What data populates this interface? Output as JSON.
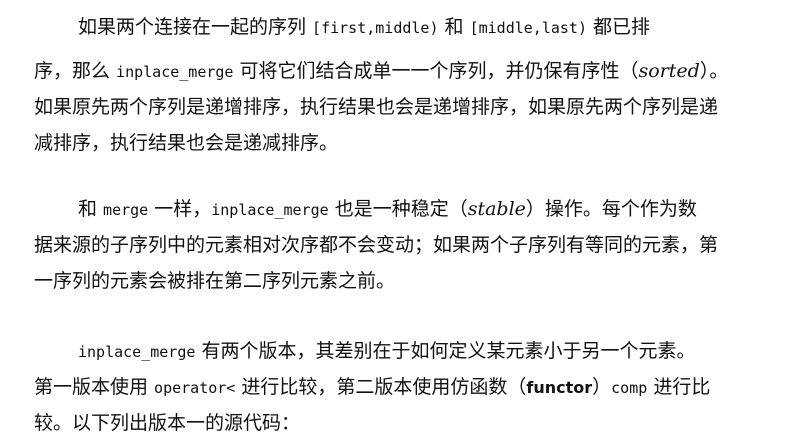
{
  "paragraphs": [
    {
      "lines": [
        [
          "如果两个连接在一起的序列 ",
          "[first,middle)",
          " 和 ",
          "[middle,last)",
          " 都已排"
        ],
        [
          "序，那么 ",
          "inplace_merge",
          " 可将它们结合成单一一个序列，并仍保有序性（",
          "sorted",
          "）。"
        ],
        [
          "如果原先两个序列是递增排序，执行结果也会是递增排序，如果原先两个序列是递"
        ],
        [
          "减排序，执行结果也会是递减排序。"
        ]
      ]
    },
    {
      "lines": [
        [
          "和 ",
          "merge",
          " 一样，",
          "inplace_merge",
          " 也是一种稳定（",
          "stable",
          "）操作。每个作为数"
        ],
        [
          "据来源的子序列中的元素相对次序都不会变动；如果两个子序列有等同的元素，第"
        ],
        [
          "一序列的元素会被排在第二序列元素之前。"
        ]
      ]
    },
    {
      "lines": [
        [
          "inplace_merge",
          " 有两个版本，其差别在于如何定义某元素小于另一个元素。"
        ],
        [
          "第一版本使用 ",
          "operator<",
          " 进行比较，第二版本使用仿函数（",
          "functor",
          "）",
          "comp",
          " 进行比"
        ],
        [
          "较。以下列出版本一的源代码："
        ]
      ]
    }
  ]
}
